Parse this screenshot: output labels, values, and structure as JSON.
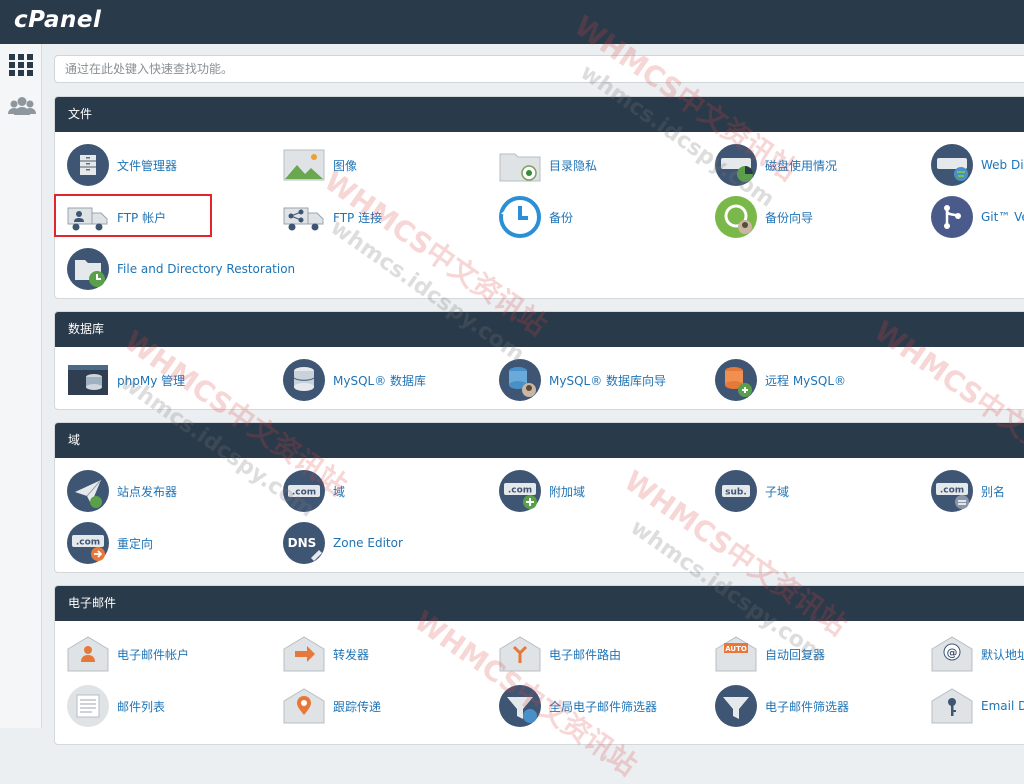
{
  "brand": {
    "logo": "cPanel"
  },
  "search": {
    "placeholder": "通过在此处键入快速查找功能。"
  },
  "sections": [
    {
      "title": "文件",
      "items": [
        {
          "label": "文件管理器",
          "icon": "file-manager-icon"
        },
        {
          "label": "图像",
          "icon": "images-icon"
        },
        {
          "label": "目录隐私",
          "icon": "directory-privacy-icon"
        },
        {
          "label": "磁盘使用情况",
          "icon": "disk-usage-icon"
        },
        {
          "label": "Web Disk",
          "icon": "web-disk-icon"
        },
        {
          "label": "FTP 帐户",
          "icon": "ftp-accounts-icon"
        },
        {
          "label": "FTP 连接",
          "icon": "ftp-connections-icon"
        },
        {
          "label": "备份",
          "icon": "backup-icon"
        },
        {
          "label": "备份向导",
          "icon": "backup-wizard-icon"
        },
        {
          "label": "Git™ Version Control",
          "icon": "git-icon"
        },
        {
          "label": "File and Directory Restoration",
          "icon": "file-restoration-icon"
        }
      ]
    },
    {
      "title": "数据库",
      "items": [
        {
          "label": "phpMy 管理",
          "icon": "phpmyadmin-icon"
        },
        {
          "label": "MySQL® 数据库",
          "icon": "mysql-databases-icon"
        },
        {
          "label": "MySQL® 数据库向导",
          "icon": "mysql-wizard-icon"
        },
        {
          "label": "远程 MySQL®",
          "icon": "remote-mysql-icon"
        }
      ]
    },
    {
      "title": "域",
      "items": [
        {
          "label": "站点发布器",
          "icon": "site-publisher-icon"
        },
        {
          "label": "域",
          "icon": "domains-icon"
        },
        {
          "label": "附加域",
          "icon": "addon-domains-icon"
        },
        {
          "label": "子域",
          "icon": "subdomains-icon"
        },
        {
          "label": "别名",
          "icon": "aliases-icon"
        },
        {
          "label": "重定向",
          "icon": "redirects-icon"
        },
        {
          "label": "Zone Editor",
          "icon": "zone-editor-icon"
        }
      ]
    },
    {
      "title": "电子邮件",
      "items": [
        {
          "label": "电子邮件帐户",
          "icon": "email-accounts-icon"
        },
        {
          "label": "转发器",
          "icon": "forwarders-icon"
        },
        {
          "label": "电子邮件路由",
          "icon": "email-routing-icon"
        },
        {
          "label": "自动回复器",
          "icon": "autoresponders-icon"
        },
        {
          "label": "默认地址",
          "icon": "default-address-icon"
        },
        {
          "label": "邮件列表",
          "icon": "mailing-lists-icon"
        },
        {
          "label": "跟踪传递",
          "icon": "track-delivery-icon"
        },
        {
          "label": "全局电子邮件筛选器",
          "icon": "global-email-filters-icon"
        },
        {
          "label": "电子邮件筛选器",
          "icon": "email-filters-icon"
        },
        {
          "label": "Email Deliverability",
          "icon": "email-deliverability-icon"
        }
      ]
    }
  ],
  "watermarks": [
    "WHMCS中文资讯站",
    "whmcs.idcspy.com"
  ],
  "colors": {
    "header": "#293a4a",
    "link": "#1f74b6",
    "highlight": "#e0262c",
    "accent_green": "#5cb85c",
    "accent_blue": "#2a8fd6"
  }
}
